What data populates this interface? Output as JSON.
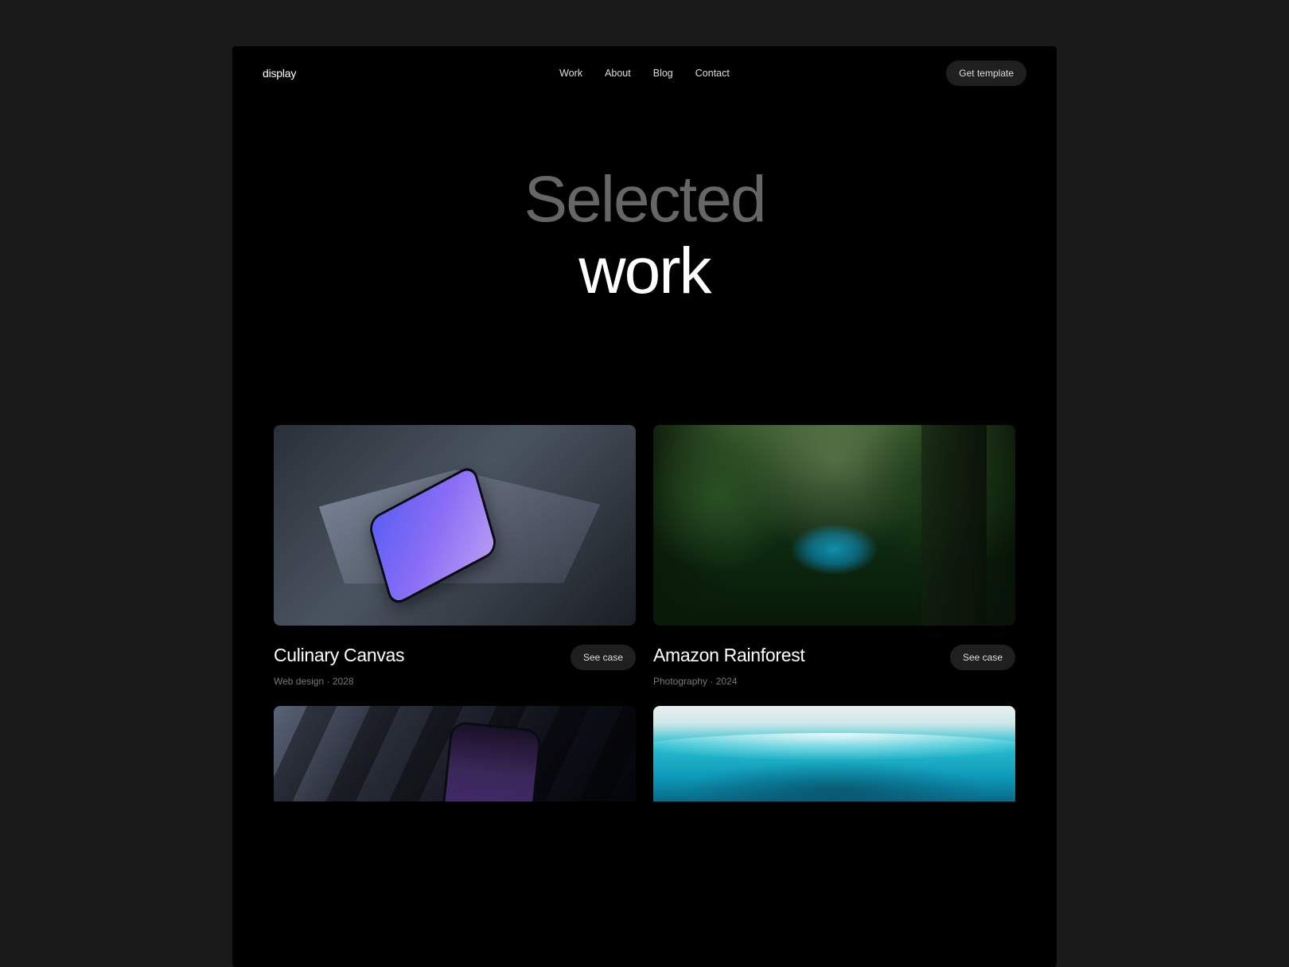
{
  "brand": "display",
  "nav": {
    "items": [
      "Work",
      "About",
      "Blog",
      "Contact"
    ]
  },
  "cta": "Get template",
  "hero": {
    "line1": "Selected",
    "line2": "work"
  },
  "cards": [
    {
      "title": "Culinary Canvas",
      "category": "Web design",
      "year": "2028",
      "button": "See case"
    },
    {
      "title": "Amazon Rainforest",
      "category": "Photography",
      "year": "2024",
      "button": "See case"
    }
  ],
  "meta_separator": " · "
}
